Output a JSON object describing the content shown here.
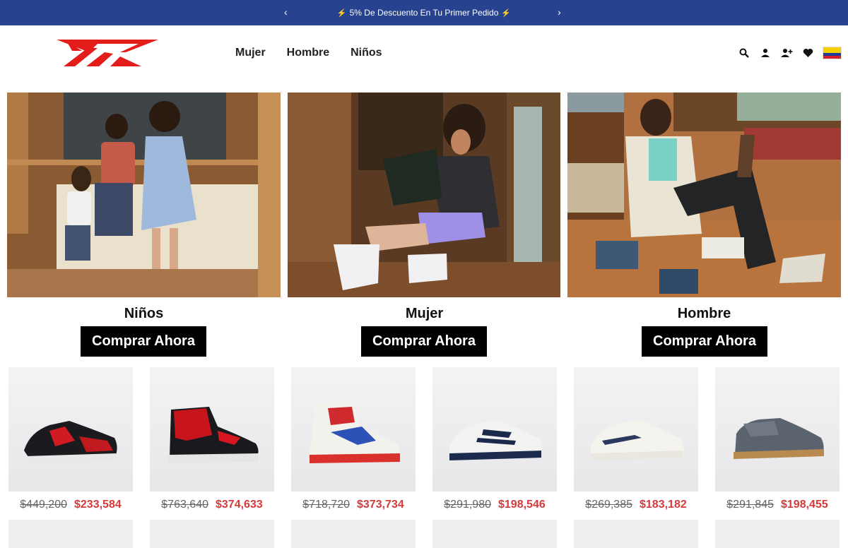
{
  "promo": {
    "text": "5% De Descuento En Tu Primer Pedido",
    "bg": "#27438f"
  },
  "nav": {
    "items": [
      {
        "label": "Mujer"
      },
      {
        "label": "Hombre"
      },
      {
        "label": "Niños"
      }
    ]
  },
  "header_icons": [
    "search-icon",
    "account-icon",
    "register-icon",
    "wishlist-icon",
    "colombia-flag-icon"
  ],
  "categories": [
    {
      "title": "Niños",
      "button": "Comprar Ahora"
    },
    {
      "title": "Mujer",
      "button": "Comprar Ahora"
    },
    {
      "title": "Hombre",
      "button": "Comprar Ahora"
    }
  ],
  "products": [
    {
      "old_price": "$449,200",
      "new_price": "$233,584"
    },
    {
      "old_price": "$763,640",
      "new_price": "$374,633"
    },
    {
      "old_price": "$718,720",
      "new_price": "$373,734"
    },
    {
      "old_price": "$291,980",
      "new_price": "$198,546"
    },
    {
      "old_price": "$269,385",
      "new_price": "$183,182"
    },
    {
      "old_price": "$291,845",
      "new_price": "$198,455"
    }
  ],
  "colors": {
    "brand_red": "#e31d1a",
    "sale_red": "#d43a3a",
    "button_black": "#000000"
  }
}
